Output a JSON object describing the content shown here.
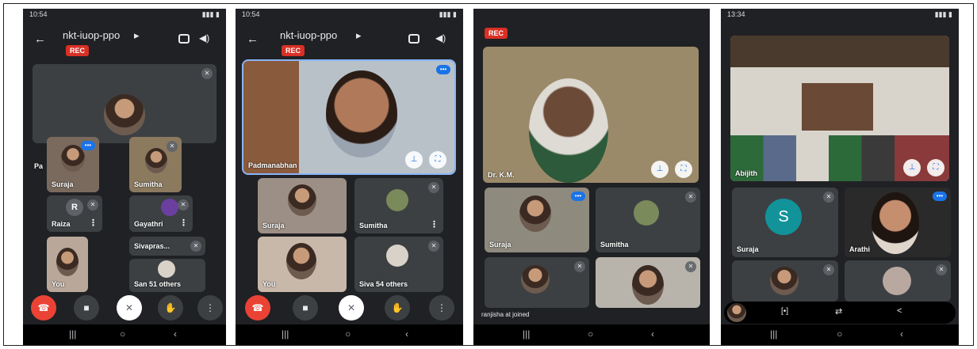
{
  "phone1": {
    "status_time": "10:54",
    "meeting_title": "nkt-iuop-ppo",
    "rec_label": "REC",
    "tiles": {
      "left_partial_name": "Pa",
      "suraja": "Suraja",
      "sumitha": "Sumitha",
      "raiza": "Raiza",
      "raiza_initial": "R",
      "gayathri": "Gayathri",
      "sivaprasad": "Sivapras...",
      "you": "You",
      "others": "San 51 others"
    }
  },
  "phone2": {
    "status_time": "10:54",
    "meeting_title": "nkt-iuop-ppo",
    "rec_label": "REC",
    "tiles": {
      "main": "Padmanabhan",
      "suraja": "Suraja",
      "sumitha": "Sumitha",
      "you": "You",
      "others": "Siva 54 others"
    }
  },
  "phone3": {
    "rec_label": "REC",
    "tiles": {
      "main": "Dr. K.M.",
      "suraja": "Suraja",
      "sumitha": "Sumitha"
    },
    "banner": "ranjisha at joined"
  },
  "phone4": {
    "status_time": "13:34",
    "tiles": {
      "main": "Abijith",
      "suraja": "Suraja",
      "suraja_initial": "S",
      "arathi": "Arathi"
    }
  },
  "colors": {
    "background": "#202124",
    "tile": "#3c4043",
    "rec": "#d93025",
    "end_call": "#ea4335",
    "accent": "#1a73e8",
    "avatar_teal": "#12939a",
    "avatar_grey": "#5f6368"
  }
}
